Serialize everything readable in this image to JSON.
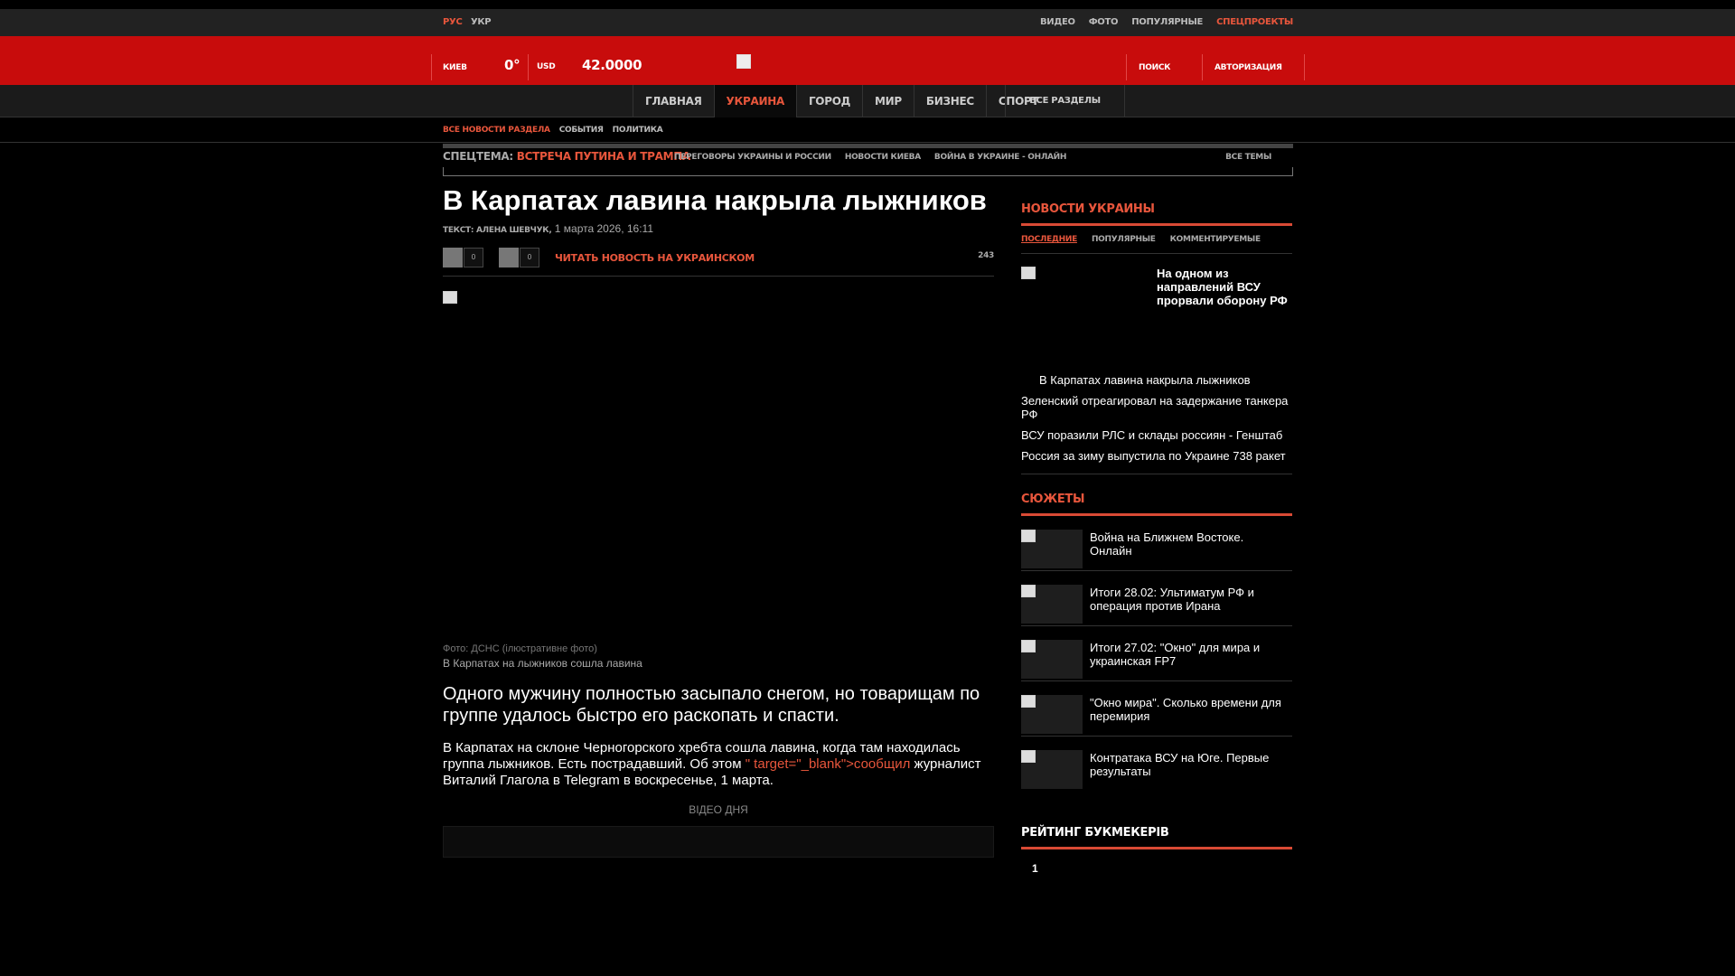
{
  "header": {
    "lang_ru": "РУС",
    "lang_ua": "УКР",
    "top_links": [
      "ВИДЕО",
      "ФОТО",
      "ПОПУЛЯРНЫЕ",
      "СПЕЦПРОЕКТЫ"
    ],
    "city": "КИЕВ",
    "temperature": "0°",
    "currency": "USD",
    "rate": "42.0000",
    "search": "ПОИСК",
    "auth": "АВТОРИЗАЦИЯ"
  },
  "nav": {
    "items": [
      "ГЛАВНАЯ",
      "УКРАИНА",
      "ГОРОД",
      "МИР",
      "БИЗНЕС",
      "СПОРТ"
    ],
    "active": "УКРАИНА",
    "all_sections": "ВСЕ РАЗДЕЛЫ"
  },
  "subnav": [
    "ВСЕ НОВОСТИ РАЗДЕЛА",
    "СОБЫТИЯ",
    "ПОЛИТИКА"
  ],
  "special": {
    "label": "СПЕЦТЕМА:",
    "topic": "ВСТРЕЧА ПУТИНА И ТРАМПА",
    "links": [
      "ПЕРЕГОВОРЫ УКРАИНЫ И РОССИИ",
      "НОВОСТИ КИЕВА",
      "ВОЙНА В УКРАИНЕ - ОНЛАЙН"
    ],
    "all_topics": "ВСЕ ТЕМЫ"
  },
  "article": {
    "title": "В Карпатах лавина накрыла лыжников",
    "author": "ТЕКСТ: АЛЕНА ШЕВЧУК,",
    "date": "1 марта 2026, 16:11",
    "share1_count": "0",
    "share2_count": "0",
    "read_ua": "ЧИТАТЬ НОВОСТЬ НА УКРАИНСКОМ",
    "views": "243",
    "photo_credit": "Фото: ДСНС (іл­юстративне фото)",
    "photo_caption": "В Карпатах на лыжников сошла лавина",
    "lead": "Одного мужчину полностью засыпало снегом, но товарищам по группе удалось быстро его раскопать и спасти.",
    "body_start": "В Карпатах на склоне Черногорского хребта сошла лавина, когда там находилась группа лыжников. Есть пострадавший. Об этом ",
    "body_link": "\" target=\"_blank\">сообщил",
    "body_end": " журналист Виталий Глагола в Telegram в воскресенье, 1 марта.",
    "video_of_day": "ВІДЕО ДНЯ"
  },
  "sidebar": {
    "news_title": "НОВОСТИ УКРАИНЫ",
    "tabs": [
      "ПОСЛЕДНИЕ",
      "ПОПУЛЯРНЫЕ",
      "КОММЕНТИРУЕМЫЕ"
    ],
    "featured": "На одном из направлений ВСУ прорвали оборону РФ",
    "news": [
      "В Карпатах лавина накрыла лыжников",
      "Зеленский отреагировал на задержание танкера РФ",
      "ВСУ поразили РЛС и склады россиян - Генштаб",
      "Россия за зиму выпустила по Украине 738 ракет"
    ],
    "stories_title": "СЮЖЕТЫ",
    "stories": [
      "Война на Ближнем Востоке. Онлайн",
      "Итоги 28.02: Ультиматум РФ и операция против Ирана",
      "Итоги 27.02: \"Окно\" для мира и украинская FP7",
      "\"Окно мира\". Сколько времени для перемирия",
      "Контратака ВСУ на Юге. Первые результаты"
    ],
    "rating_title": "РЕЙТИНГ БУКМЕКЕРІВ",
    "rating_first": "1"
  },
  "colors": {
    "accent": "#e8563c",
    "header_red": "#c80c0c",
    "bg": "#000000"
  }
}
